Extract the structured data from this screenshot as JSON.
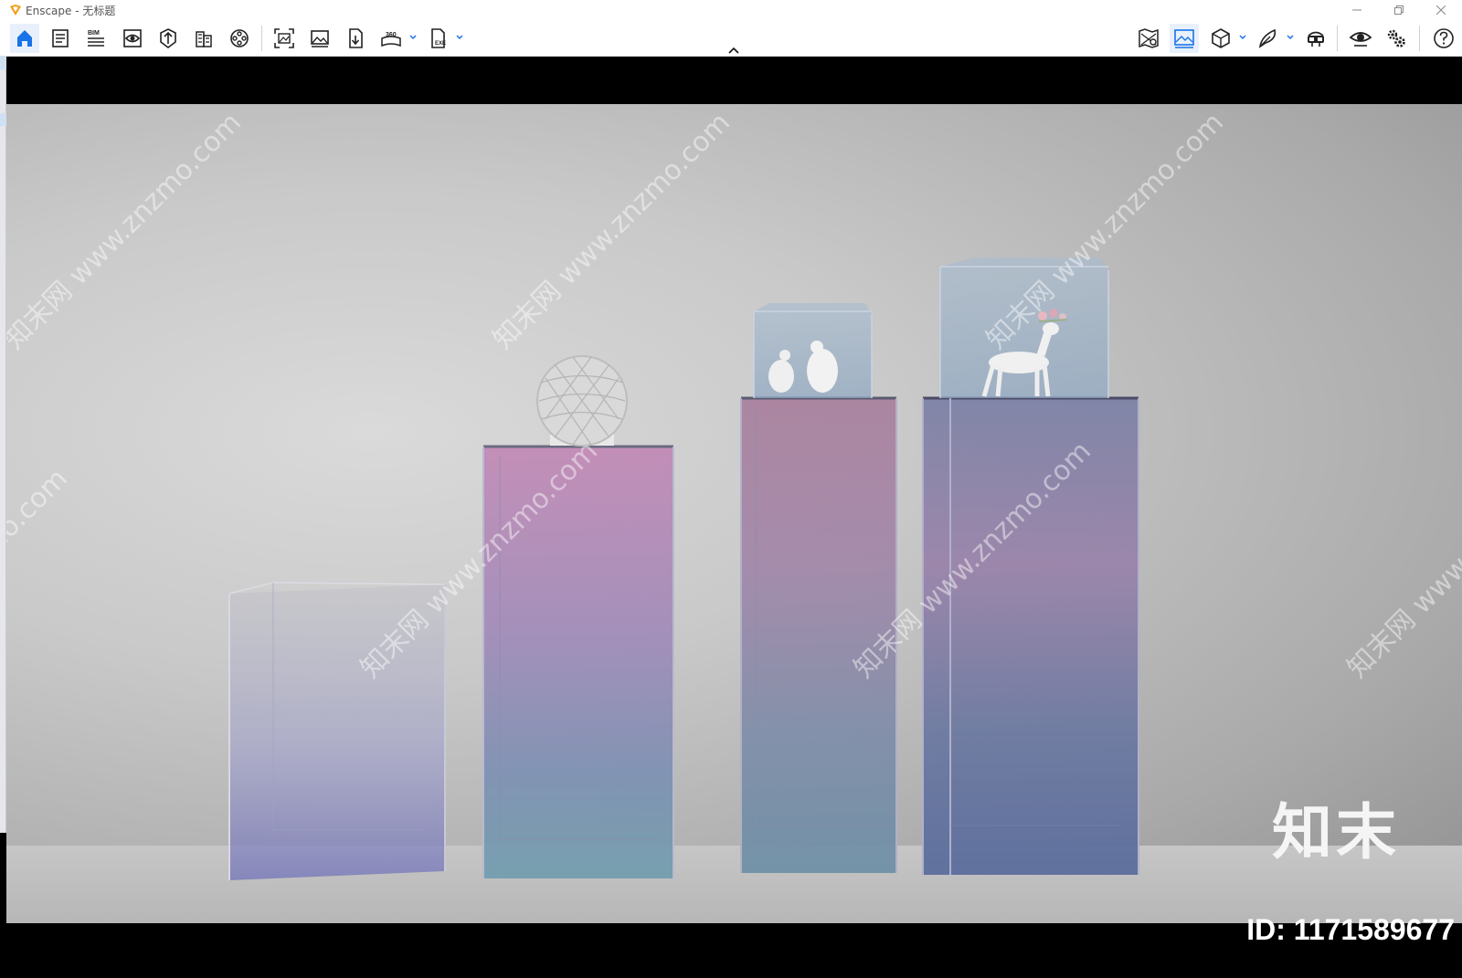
{
  "window": {
    "app_name": "Enscape",
    "title": "Enscape - 无标题",
    "accent_color": "#1a73e8"
  },
  "toolbar": {
    "left_buttons": [
      {
        "name": "home-icon",
        "active": true
      },
      {
        "name": "settings-doc-icon"
      },
      {
        "name": "bim-icon",
        "label": "BIM"
      },
      {
        "name": "views-icon"
      },
      {
        "name": "asset-library-icon"
      },
      {
        "name": "building-icon"
      },
      {
        "name": "reel-icon"
      },
      {
        "name": "screenshot-icon"
      },
      {
        "name": "image-icon"
      },
      {
        "name": "export-icon"
      },
      {
        "name": "panorama-360-icon",
        "label": "360"
      },
      {
        "name": "exe-export-icon",
        "label": "EXE"
      }
    ],
    "right_buttons": [
      {
        "name": "map-icon"
      },
      {
        "name": "visual-settings-icon",
        "active": true
      },
      {
        "name": "cube-icon"
      },
      {
        "name": "feather-icon"
      },
      {
        "name": "vr-headset-icon"
      },
      {
        "name": "eye-icon"
      },
      {
        "name": "gears-icon"
      },
      {
        "name": "help-icon"
      }
    ]
  },
  "viewport": {
    "watermark": "知末网 www.znzmo.com",
    "brand": "知末",
    "id_text": "ID: 1171589677"
  }
}
